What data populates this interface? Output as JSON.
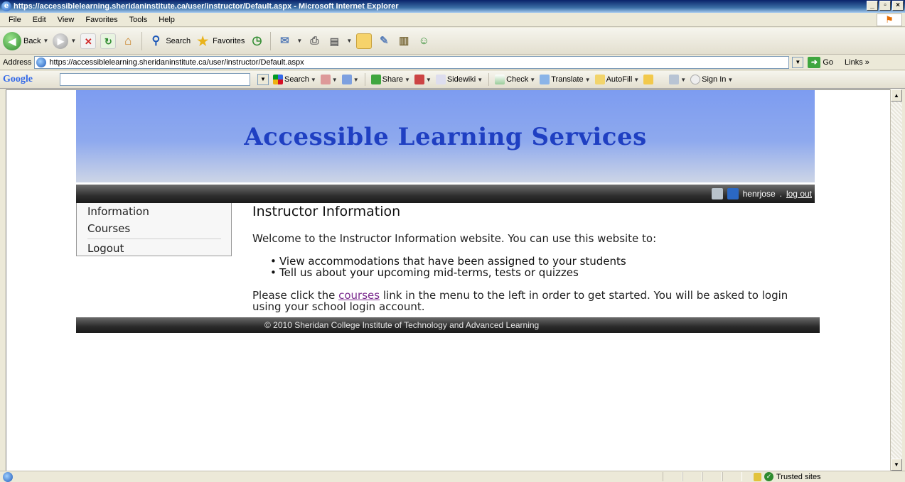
{
  "window": {
    "title": "https://accessiblelearning.sheridaninstitute.ca/user/instructor/Default.aspx - Microsoft Internet Explorer",
    "min": "_",
    "max": "▫",
    "close": "×"
  },
  "menu": [
    "File",
    "Edit",
    "View",
    "Favorites",
    "Tools",
    "Help"
  ],
  "toolbar": {
    "back": "Back",
    "search": "Search",
    "favorites": "Favorites"
  },
  "address": {
    "label": "Address",
    "url": "https://accessiblelearning.sheridaninstitute.ca/user/instructor/Default.aspx",
    "go": "Go",
    "links": "Links"
  },
  "google": {
    "logo": "Google",
    "search": "Search",
    "share": "Share",
    "sidewiki": "Sidewiki",
    "check": "Check",
    "translate": "Translate",
    "autofill": "AutoFill",
    "signin": "Sign In"
  },
  "page": {
    "banner": "Accessible Learning Services",
    "user": "henrjose",
    "separator": ".",
    "logout_link": "log out",
    "side_menu": [
      "Information",
      "Courses",
      "Logout"
    ],
    "heading": "Instructor Information",
    "welcome": "Welcome to the Instructor Information website. You can use this website to:",
    "bullets": [
      "View accommodations that have been assigned to your students",
      "Tell us about your upcoming mid-terms, tests or quizzes"
    ],
    "please_prefix": "Please click the ",
    "courses_link": "courses",
    "please_suffix": " link in the menu to the left in order to get started. You will be asked to login using your school login account.",
    "footer": "© 2010 Sheridan College Institute of Technology and Advanced Learning"
  },
  "status": {
    "zone": "Trusted sites"
  }
}
